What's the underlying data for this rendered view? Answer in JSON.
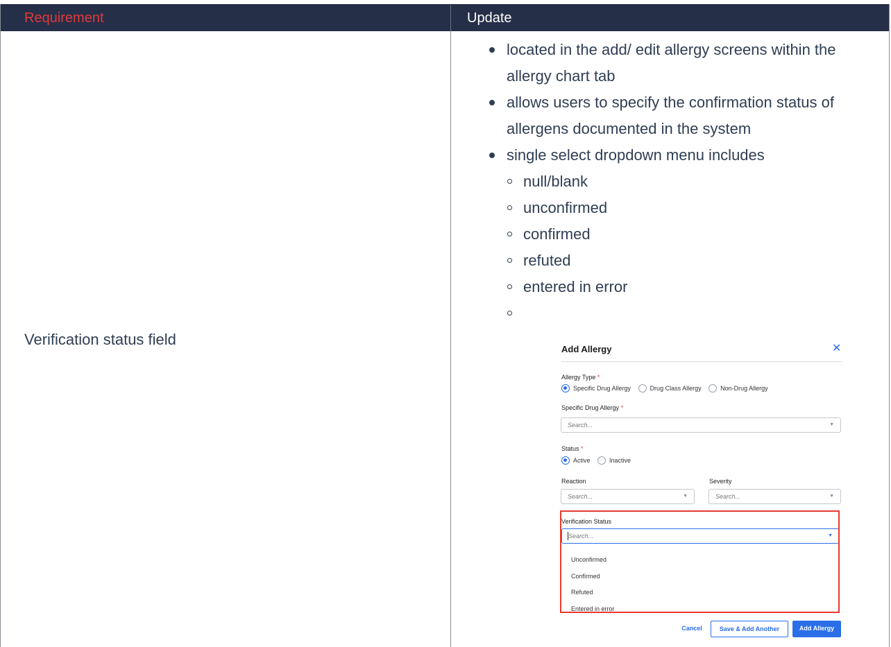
{
  "table": {
    "headers": {
      "requirement": "Requirement",
      "update": "Update"
    },
    "row": {
      "requirement": "Verification status field",
      "bullets": [
        {
          "line1": "located in the add/ edit allergy screens within the",
          "line2": "allergy chart tab"
        },
        {
          "line1": "allows users to specify the confirmation status of",
          "line2": "allergens documented in the system"
        },
        {
          "line1": "single select dropdown menu includes"
        }
      ],
      "sub_bullets": [
        "null/blank",
        "unconfirmed",
        "confirmed",
        "refuted",
        "entered in error",
        ""
      ]
    }
  },
  "screenshot": {
    "title": "Add Allergy",
    "close_icon": "close-icon",
    "allergy_type_label": "Allergy Type",
    "required_mark": "*",
    "allergy_type_options": [
      "Specific Drug Allergy",
      "Drug Class Allergy",
      "Non-Drug Allergy"
    ],
    "allergy_type_selected": "Specific Drug Allergy",
    "specific_drug_label": "Specific Drug Allergy",
    "search_placeholder": "Search...",
    "status_label": "Status",
    "status_options": [
      "Active",
      "Inactive"
    ],
    "status_selected": "Active",
    "reaction_label": "Reaction",
    "severity_label": "Severity",
    "verification_label": "Verification Status",
    "verification_options": [
      "Unconfirmed",
      "Confirmed",
      "Refuted",
      "Entered in error"
    ],
    "highlight_color": "#e63a2e",
    "accent_color": "#2b6ee8",
    "buttons": {
      "cancel": "Cancel",
      "save_another": "Save & Add Another",
      "add": "Add Allergy"
    }
  }
}
